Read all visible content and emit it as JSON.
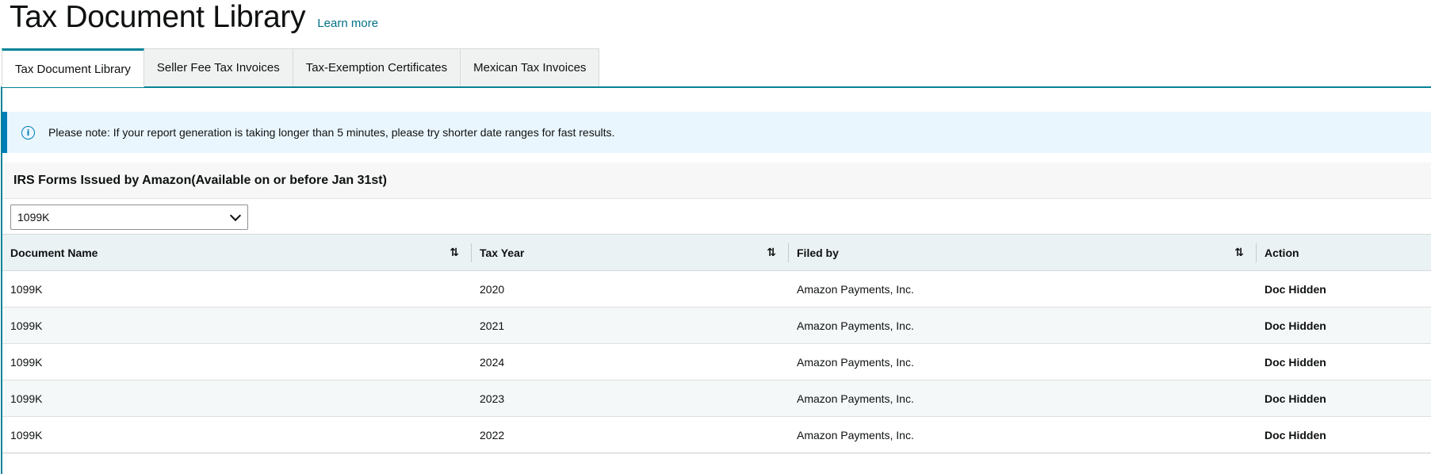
{
  "header": {
    "title": "Tax Document Library",
    "learn_more": "Learn more"
  },
  "tabs": [
    {
      "label": "Tax Document Library",
      "active": true
    },
    {
      "label": "Seller Fee Tax Invoices",
      "active": false
    },
    {
      "label": "Tax-Exemption Certificates",
      "active": false
    },
    {
      "label": "Mexican Tax Invoices",
      "active": false
    }
  ],
  "alert": {
    "icon": "info-icon",
    "text": "Please note: If your report generation is taking longer than 5 minutes, please try shorter date ranges for fast results."
  },
  "section": {
    "title": "IRS Forms Issued by Amazon(Available on or before Jan 31st)"
  },
  "filter": {
    "selected": "1099K"
  },
  "table": {
    "columns": [
      "Document Name",
      "Tax Year",
      "Filed by",
      "Action"
    ],
    "rows": [
      {
        "document": "1099K",
        "year": "2020",
        "filed_by": "Amazon Payments, Inc.",
        "action": "Doc Hidden"
      },
      {
        "document": "1099K",
        "year": "2021",
        "filed_by": "Amazon Payments, Inc.",
        "action": "Doc Hidden"
      },
      {
        "document": "1099K",
        "year": "2024",
        "filed_by": "Amazon Payments, Inc.",
        "action": "Doc Hidden"
      },
      {
        "document": "1099K",
        "year": "2023",
        "filed_by": "Amazon Payments, Inc.",
        "action": "Doc Hidden"
      },
      {
        "document": "1099K",
        "year": "2022",
        "filed_by": "Amazon Payments, Inc.",
        "action": "Doc Hidden"
      }
    ]
  },
  "colors": {
    "accent": "#008296",
    "link": "#007185",
    "info": "#007eb9"
  }
}
